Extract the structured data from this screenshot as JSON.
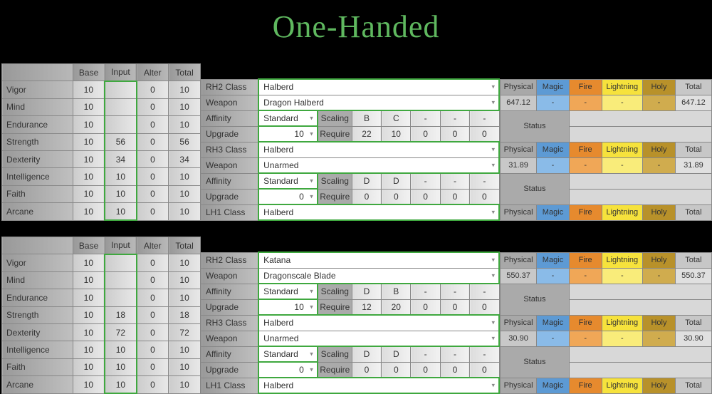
{
  "title": "One-Handed",
  "labels": {
    "base": "Base",
    "input": "Input",
    "alter": "Alter",
    "total": "Total",
    "rh2": "RH2 Class",
    "rh3": "RH3 Class",
    "lh1": "LH1 Class",
    "weapon": "Weapon",
    "affinity": "Affinity",
    "upgrade": "Upgrade",
    "scaling": "Scaling",
    "require": "Require",
    "physical": "Physical",
    "magic": "Magic",
    "fire": "Fire",
    "lightning": "Lightning",
    "holy": "Holy",
    "status": "Status"
  },
  "statNames": [
    "Vigor",
    "Mind",
    "Endurance",
    "Strength",
    "Dexterity",
    "Intelligence",
    "Faith",
    "Arcane"
  ],
  "top": {
    "stats": [
      {
        "base": 10,
        "input": "",
        "alter": 0,
        "total": 10
      },
      {
        "base": 10,
        "input": "",
        "alter": 0,
        "total": 10
      },
      {
        "base": 10,
        "input": "",
        "alter": 0,
        "total": 10
      },
      {
        "base": 10,
        "input": "56",
        "alter": 0,
        "total": 56
      },
      {
        "base": 10,
        "input": "34",
        "alter": 0,
        "total": 34
      },
      {
        "base": 10,
        "input": "10",
        "alter": 0,
        "total": 10
      },
      {
        "base": 10,
        "input": "10",
        "alter": 0,
        "total": 10
      },
      {
        "base": 10,
        "input": "10",
        "alter": 0,
        "total": 10
      }
    ],
    "rh2": {
      "class": "Halberd",
      "weapon": "Dragon Halberd",
      "affinity": "Standard",
      "upgrade": "10",
      "scaling": [
        "B",
        "C",
        "-",
        "-",
        "-"
      ],
      "require": [
        "22",
        "10",
        "0",
        "0",
        "0"
      ],
      "dmg": {
        "phys": "647.12",
        "magic": "-",
        "fire": "-",
        "light": "-",
        "holy": "-",
        "total": "647.12"
      },
      "status": ""
    },
    "rh3": {
      "class": "Halberd",
      "weapon": "Unarmed",
      "affinity": "Standard",
      "upgrade": "0",
      "scaling": [
        "D",
        "D",
        "-",
        "-",
        "-"
      ],
      "require": [
        "0",
        "0",
        "0",
        "0",
        "0"
      ],
      "dmg": {
        "phys": "31.89",
        "magic": "-",
        "fire": "-",
        "light": "-",
        "holy": "-",
        "total": "31.89"
      },
      "status": ""
    },
    "lh1": {
      "class": "Halberd"
    }
  },
  "bottom": {
    "stats": [
      {
        "base": 10,
        "input": "",
        "alter": 0,
        "total": 10
      },
      {
        "base": 10,
        "input": "",
        "alter": 0,
        "total": 10
      },
      {
        "base": 10,
        "input": "",
        "alter": 0,
        "total": 10
      },
      {
        "base": 10,
        "input": "18",
        "alter": 0,
        "total": 18
      },
      {
        "base": 10,
        "input": "72",
        "alter": 0,
        "total": 72
      },
      {
        "base": 10,
        "input": "10",
        "alter": 0,
        "total": 10
      },
      {
        "base": 10,
        "input": "10",
        "alter": 0,
        "total": 10
      },
      {
        "base": 10,
        "input": "10",
        "alter": 0,
        "total": 10
      }
    ],
    "rh2": {
      "class": "Katana",
      "weapon": "Dragonscale Blade",
      "affinity": "Standard",
      "upgrade": "10",
      "scaling": [
        "D",
        "B",
        "-",
        "-",
        "-"
      ],
      "require": [
        "12",
        "20",
        "0",
        "0",
        "0"
      ],
      "dmg": {
        "phys": "550.37",
        "magic": "-",
        "fire": "-",
        "light": "-",
        "holy": "-",
        "total": "550.37"
      },
      "status": ""
    },
    "rh3": {
      "class": "Halberd",
      "weapon": "Unarmed",
      "affinity": "Standard",
      "upgrade": "0",
      "scaling": [
        "D",
        "D",
        "-",
        "-",
        "-"
      ],
      "require": [
        "0",
        "0",
        "0",
        "0",
        "0"
      ],
      "dmg": {
        "phys": "30.90",
        "magic": "-",
        "fire": "-",
        "light": "-",
        "holy": "-",
        "total": "30.90"
      },
      "status": ""
    },
    "lh1": {
      "class": "Halberd"
    }
  }
}
